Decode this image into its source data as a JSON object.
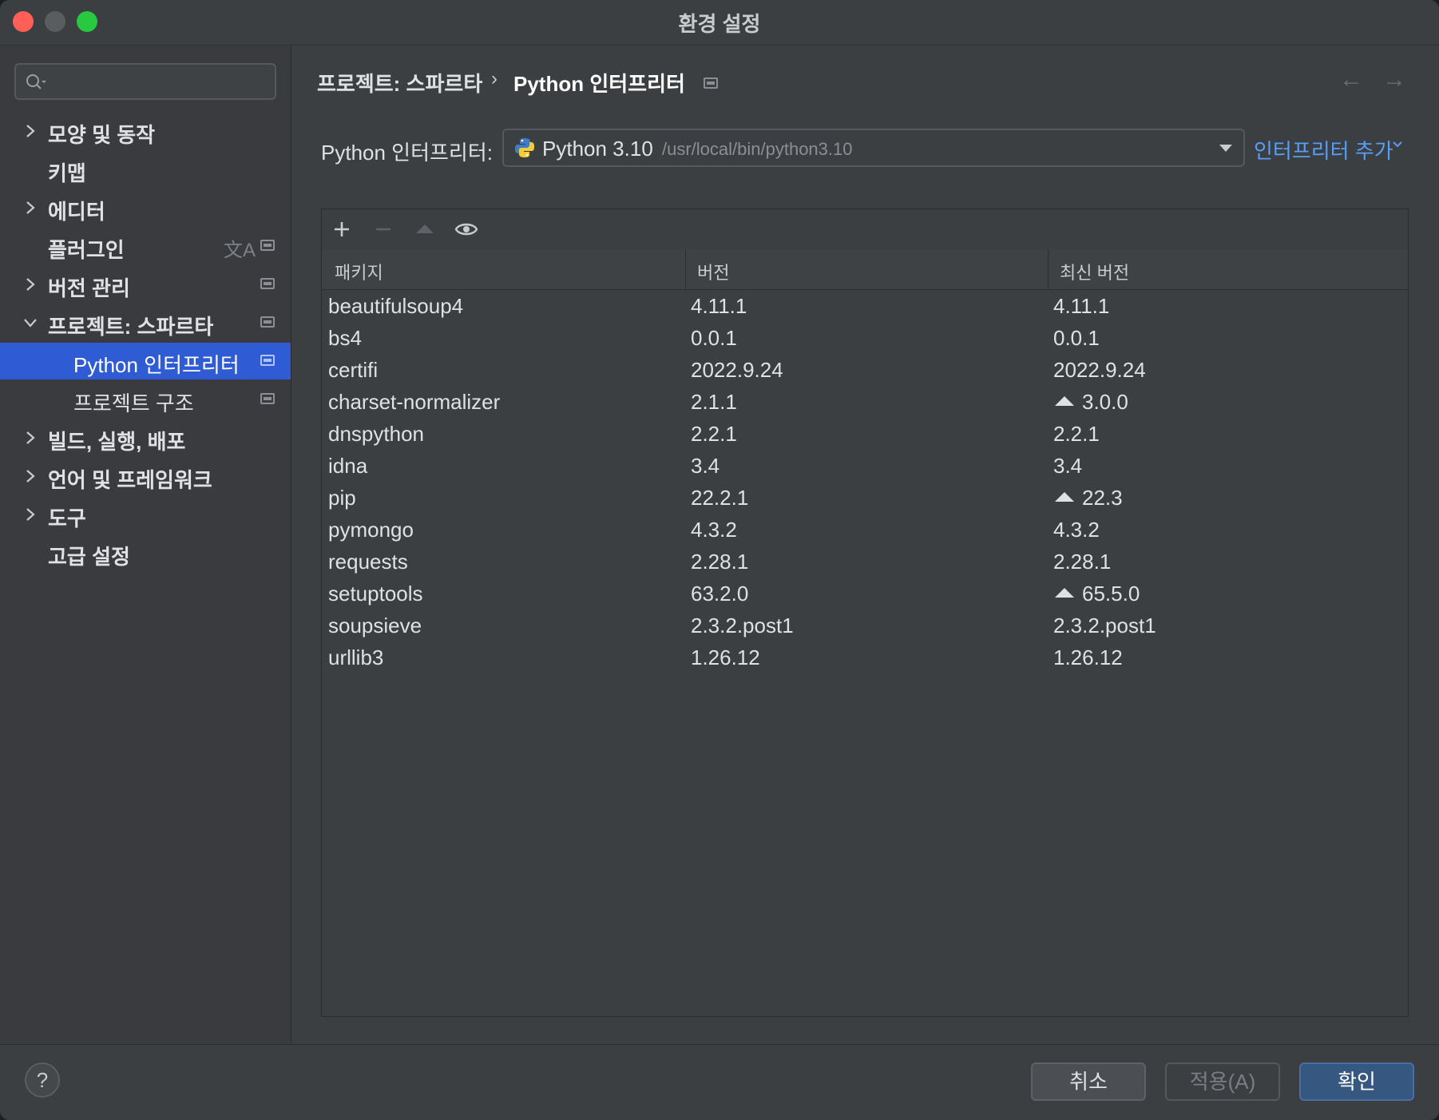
{
  "window": {
    "title": "환경 설정"
  },
  "sidebar": {
    "search_placeholder": "",
    "items": [
      {
        "label": "모양 및 동작"
      },
      {
        "label": "키맵"
      },
      {
        "label": "에디터"
      },
      {
        "label": "플러그인",
        "badge": "文A"
      },
      {
        "label": "버전 관리"
      },
      {
        "label": "프로젝트: 스파르타"
      },
      {
        "label": "Python 인터프리터"
      },
      {
        "label": "프로젝트 구조"
      },
      {
        "label": "빌드, 실행, 배포"
      },
      {
        "label": "언어 및 프레임워크"
      },
      {
        "label": "도구"
      },
      {
        "label": "고급 설정"
      }
    ]
  },
  "breadcrumb": {
    "parent": "프로젝트: 스파르타",
    "separator": "›",
    "current": "Python 인터프리터",
    "back": "←",
    "forward": "→"
  },
  "interpreter": {
    "label": "Python 인터프리터:",
    "name": "Python 3.10",
    "path": "/usr/local/bin/python3.10",
    "add_label": "인터프리터 추가"
  },
  "table": {
    "columns": [
      "패키지",
      "버전",
      "최신 버전"
    ],
    "rows": [
      {
        "package": "beautifulsoup4",
        "version": "4.11.1",
        "latest": "4.11.1",
        "upgrade": false
      },
      {
        "package": "bs4",
        "version": "0.0.1",
        "latest": "0.0.1",
        "upgrade": false
      },
      {
        "package": "certifi",
        "version": "2022.9.24",
        "latest": "2022.9.24",
        "upgrade": false
      },
      {
        "package": "charset-normalizer",
        "version": "2.1.1",
        "latest": "3.0.0",
        "upgrade": true
      },
      {
        "package": "dnspython",
        "version": "2.2.1",
        "latest": "2.2.1",
        "upgrade": false
      },
      {
        "package": "idna",
        "version": "3.4",
        "latest": "3.4",
        "upgrade": false
      },
      {
        "package": "pip",
        "version": "22.2.1",
        "latest": "22.3",
        "upgrade": true
      },
      {
        "package": "pymongo",
        "version": "4.3.2",
        "latest": "4.3.2",
        "upgrade": false
      },
      {
        "package": "requests",
        "version": "2.28.1",
        "latest": "2.28.1",
        "upgrade": false
      },
      {
        "package": "setuptools",
        "version": "63.2.0",
        "latest": "65.5.0",
        "upgrade": true
      },
      {
        "package": "soupsieve",
        "version": "2.3.2.post1",
        "latest": "2.3.2.post1",
        "upgrade": false
      },
      {
        "package": "urllib3",
        "version": "1.26.12",
        "latest": "1.26.12",
        "upgrade": false
      }
    ]
  },
  "footer": {
    "help": "?",
    "cancel": "취소",
    "apply": "적용(A)",
    "ok": "확인"
  }
}
